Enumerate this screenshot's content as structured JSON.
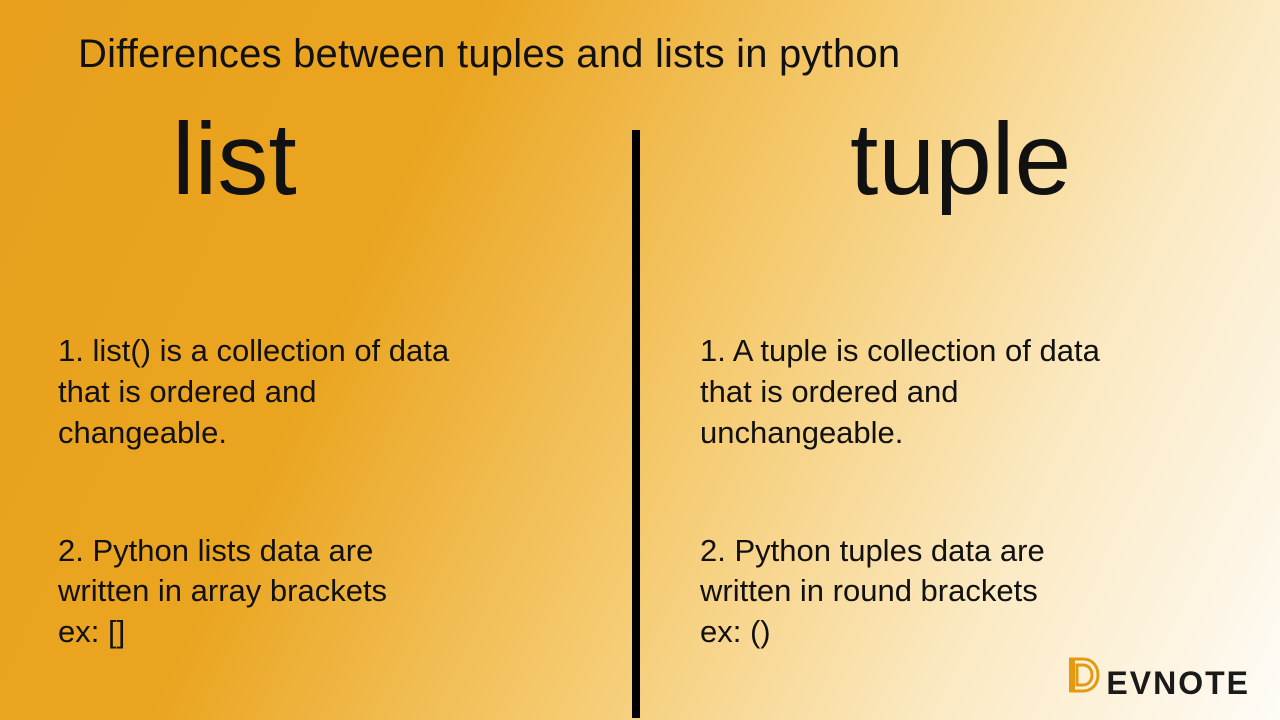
{
  "title": "Differences between tuples and lists in python",
  "left": {
    "heading": "list",
    "point1": "1. list() is a collection of data\n that is ordered and\nchangeable.",
    "point2": "2. Python lists data are\nwritten in array brackets\nex: []"
  },
  "right": {
    "heading": "tuple",
    "point1": "1. A tuple is collection of data\nthat is ordered and\nunchangeable.",
    "point2": "2. Python tuples data are\nwritten in round brackets\n ex: ()"
  },
  "logo": {
    "text": "EVNOTE"
  }
}
